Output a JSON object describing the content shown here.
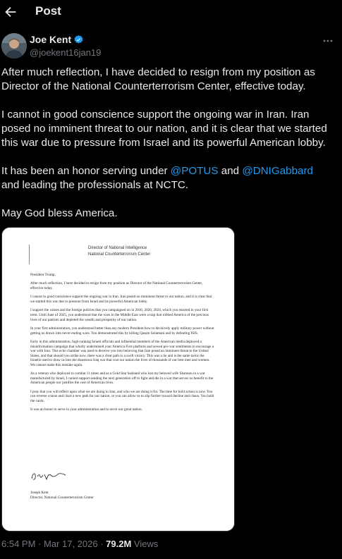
{
  "header": {
    "title": "Post"
  },
  "author": {
    "name": "Joe Kent",
    "handle": "@joekent16jan19"
  },
  "tweet": {
    "p1": "After much reflection, I have decided to resign from my position as Director of the National Counterterrorism Center, effective today.",
    "p2": "I cannot in good conscience support the ongoing war in Iran. Iran posed no imminent threat to our nation, and it is clear that we started this war due to pressure from Israel and its powerful American lobby.",
    "p3_a": "It has been an honor serving under ",
    "mention1": "@POTUS",
    "p3_b": " and ",
    "mention2": "@DNIGabbard",
    "p3_c": " and leading the professionals at NCTC.",
    "p4": "May God bless America."
  },
  "letter": {
    "letterhead_1": "Director of National Intelligence",
    "letterhead_2": "National Counterterrorism Center",
    "salutation": "President Trump,",
    "paragraphs": [
      "After much reflection, I have decided to resign from my position as Director of the National Counterterrorism Center, effective today.",
      "I cannot in good conscience support the ongoing war in Iran. Iran posed no imminent threat to our nation, and it is clear that we started this war due to pressure from Israel and its powerful American lobby.",
      "I support the values and the foreign policies that you campaigned on in 2016, 2020, 2024, which you enacted in your first term. Until June of 2025, you understood that the wars in the Middle East were a trap that robbed America of the precious lives of our patriots and depleted the wealth and prosperity of our nation.",
      "In your first administration, you understood better than any modern President how to decisively apply military power without getting us drawn into never-ending wars. You demonstrated this by killing Qasam Solamani and by defeating ISIS.",
      "Early in this administration, high-ranking Israeli officials and influential members of the American media deployed a misinformation campaign that wholly undermined your America First platform and sowed pro-war sentiments to encourage a war with Iran. This echo chamber was used to deceive you into believing that Iran posed an imminent threat to the United States, and that should you strike now, there was a clear path to a swift victory. This was a lie and is the same tactic the Israelis used to draw us into the disastrous Iraq war that cost our nation the lives of thousands of our best men and women. We cannot make this mistake again.",
      "As a veteran who deployed to combat 11 times and as a Gold Star husband who lost my beloved wife Shannon in a war manufactured by Israel, I cannot support sending the next generation off to fight and die in a war that serves no benefit to the American people nor justifies the cost of American lives.",
      "I pray that you will reflect upon what we are doing in Iran, and who we are doing it for. The time for bold action is now. You can reverse course and chart a new path for our nation, or you can allow us to slip further toward decline and chaos. You hold the cards.",
      "It was an honor to serve in your administration and to serve our great nation."
    ],
    "signer_name": "Joseph Kent",
    "signer_title": "Director, National Counterterrorism Center"
  },
  "meta": {
    "time": "6:54 PM",
    "sep1": " · ",
    "date": "Mar 17, 2026",
    "sep2": " · ",
    "views": "79.2M",
    "views_label": " Views"
  },
  "icons": {
    "back": "back-arrow-icon",
    "verified": "verified-badge-icon",
    "more": "more-options-icon"
  },
  "colors": {
    "link": "#1d9bf0",
    "muted": "#71767b",
    "text": "#e7e9ea",
    "background": "#000000"
  }
}
